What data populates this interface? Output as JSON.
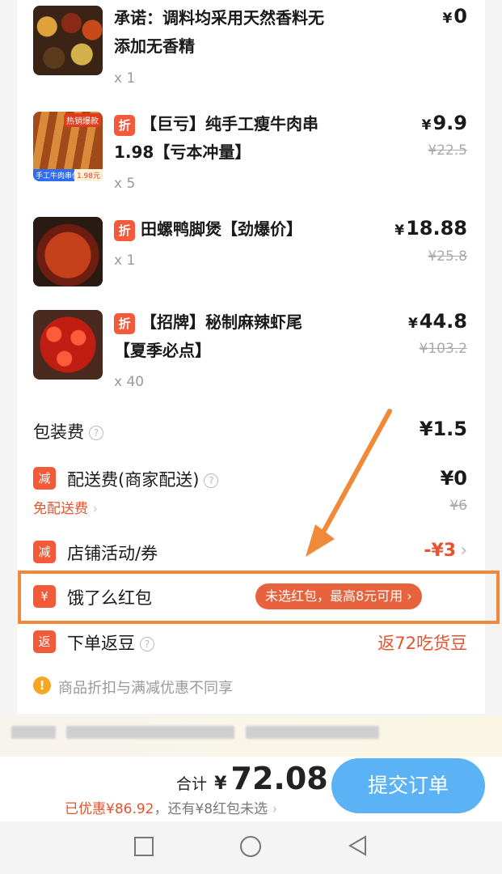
{
  "items": [
    {
      "name_line1": "承诺：调料均采用天然香料无",
      "name_line2": "添加无香精",
      "qty": "x 1",
      "price_symbol": "¥",
      "price": "0",
      "orig_price": "",
      "discount_tag": "",
      "thumb_icon": "spices-image"
    },
    {
      "name_line1": "【巨亏】纯手工瘦牛肉串",
      "name_line2": "1.98【亏本冲量】",
      "qty": "x 5",
      "price_symbol": "¥",
      "price": "9.9",
      "orig_price": "¥22.5",
      "discount_tag": "折",
      "thumb_icon": "beef-skewer-image",
      "thumb_badge": "热销爆款",
      "thumb_tag_left": "手工牛肉串仅",
      "thumb_tag_right": "1.98元"
    },
    {
      "name_line1": "田螺鸭脚煲【劲爆价】",
      "name_line2": "",
      "qty": "x 1",
      "price_symbol": "¥",
      "price": "18.88",
      "orig_price": "¥25.8",
      "discount_tag": "折",
      "thumb_icon": "duck-feet-pot-image"
    },
    {
      "name_line1": "【招牌】秘制麻辣虾尾",
      "name_line2": "【夏季必点】",
      "qty": "x 40",
      "price_symbol": "¥",
      "price": "44.8",
      "orig_price": "¥103.2",
      "discount_tag": "折",
      "thumb_icon": "crayfish-image"
    }
  ],
  "fees": {
    "packing_label": "包装费",
    "packing_value": "¥1.5",
    "delivery_tag": "减",
    "delivery_label": "配送费(商家配送)",
    "delivery_value": "¥0",
    "delivery_free_label": "免配送费",
    "delivery_orig": "¥6",
    "store_tag": "减",
    "store_label": "店铺活动/券",
    "store_value": "-¥3",
    "redpacket_tag": "¥",
    "redpacket_label": "饿了么红包",
    "redpacket_pill": "未选红包，最高8元可用",
    "bean_tag": "返",
    "bean_label": "下单返豆",
    "bean_value": "返72吃货豆",
    "notice": "商品折扣与满减优惠不同享"
  },
  "footer": {
    "total_label": "合计",
    "total_symbol": "¥",
    "total_value": "72.08",
    "saved_text": "已优惠¥86.92",
    "remaining_text": "，还有¥8红包未选",
    "submit_label": "提交订单"
  },
  "colors": {
    "accent_red": "#e5532f",
    "submit_blue": "#5bb3f5",
    "highlight_orange": "#f08a3a"
  }
}
